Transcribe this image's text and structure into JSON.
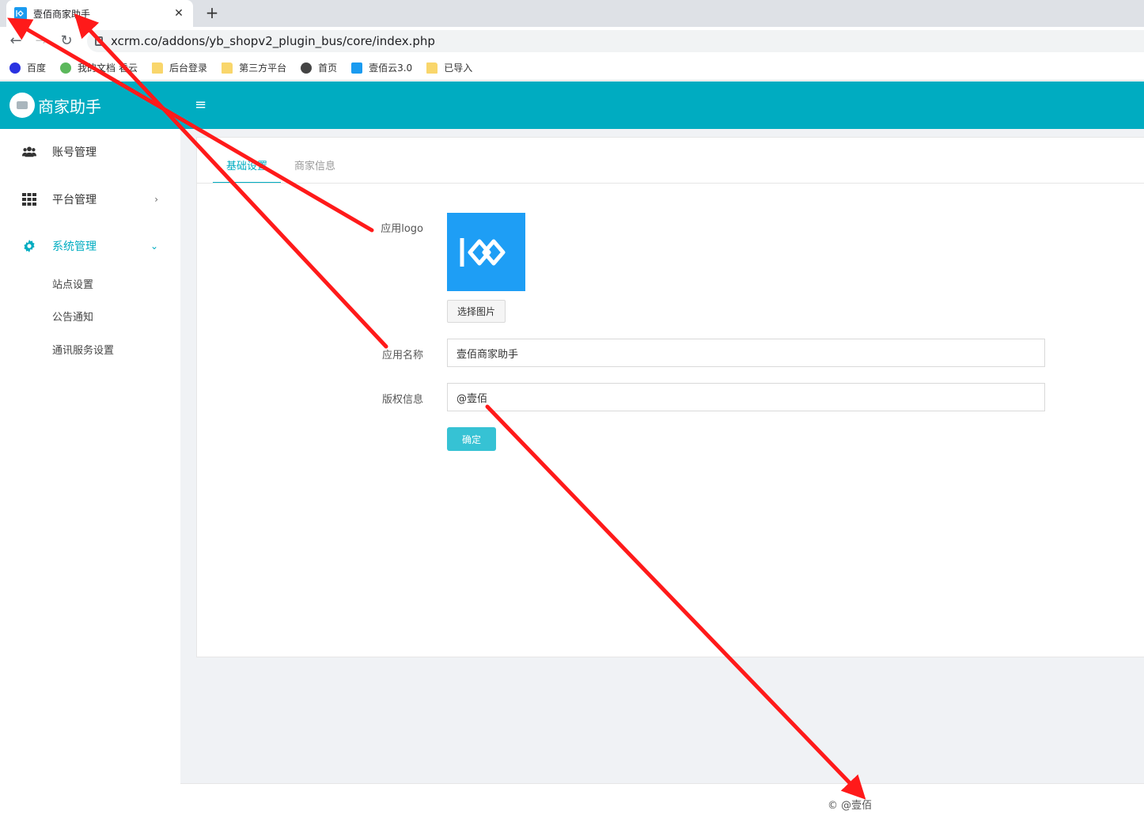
{
  "browser": {
    "tab_title": "壹佰商家助手",
    "url": "xcrm.co/addons/yb_shopv2_plugin_bus/core/index.php",
    "bookmarks": [
      {
        "label": "百度",
        "icon": "baidu-icon"
      },
      {
        "label": "我的文档",
        "icon": "cloud-icon"
      },
      {
        "label": "看云",
        "icon": "folder-icon"
      },
      {
        "label": "后台登录",
        "icon": "folder-icon"
      },
      {
        "label": "第三方平台",
        "icon": "folder-icon"
      },
      {
        "label": "首页",
        "icon": "globe-icon"
      },
      {
        "label": "壹佰云3.0",
        "icon": "yb-icon"
      },
      {
        "label": "已导入",
        "icon": "folder-icon"
      }
    ]
  },
  "header": {
    "brand": "商家助手"
  },
  "sidebar": {
    "items": [
      {
        "label": "账号管理",
        "icon": "users-icon"
      },
      {
        "label": "平台管理",
        "icon": "grid-icon"
      },
      {
        "label": "系统管理",
        "icon": "gear-icon"
      }
    ],
    "sub_items": [
      "站点设置",
      "公告通知",
      "通讯服务设置"
    ]
  },
  "main": {
    "tabs": [
      "基础设置",
      "商家信息"
    ],
    "form": {
      "logo_label": "应用logo",
      "pick_button": "选择图片",
      "name_label": "应用名称",
      "name_value": "壹佰商家助手",
      "copyright_label": "版权信息",
      "copyright_value": "@壹佰",
      "submit": "确定"
    }
  },
  "footer": {
    "text": "© @壹佰"
  },
  "colors": {
    "accent": "#00acc1",
    "annotation": "#ff0000",
    "logo_bg": "#1e9ef5"
  }
}
